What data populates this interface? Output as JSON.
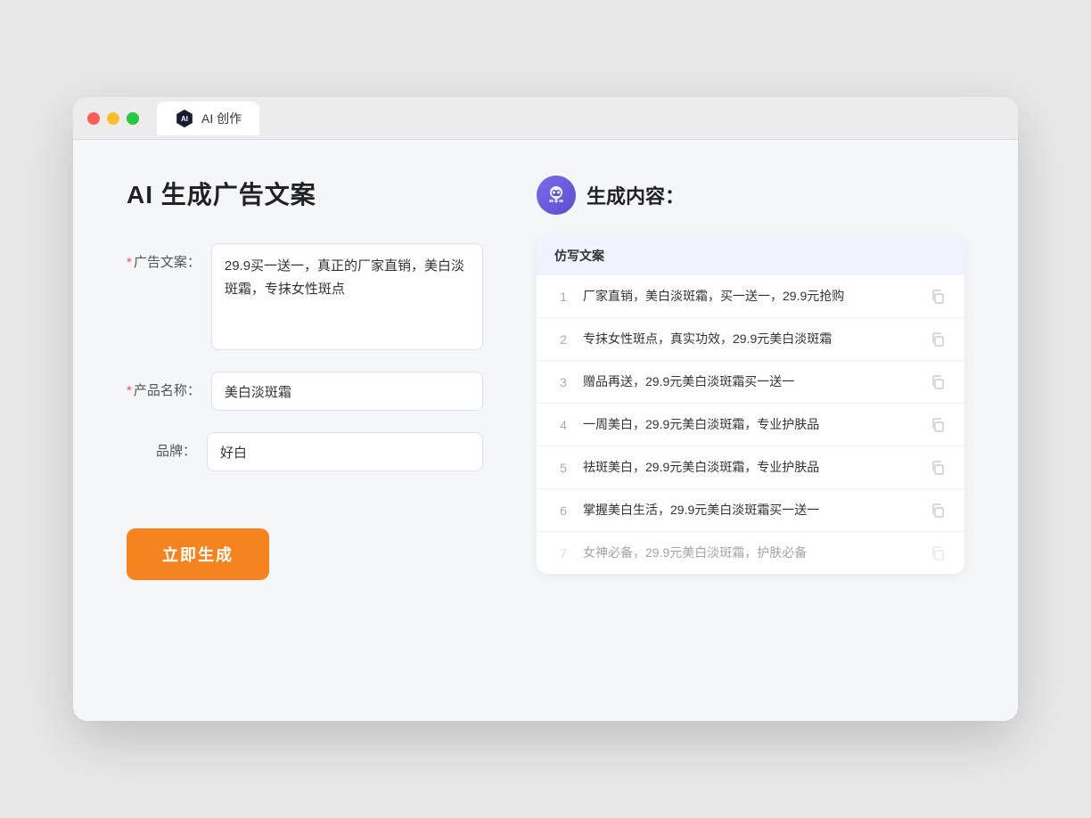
{
  "browser": {
    "tab_label": "AI 创作"
  },
  "page": {
    "title": "AI 生成广告文案"
  },
  "form": {
    "ad_copy_label": "广告文案：",
    "ad_copy_required": "*",
    "ad_copy_value": "29.9买一送一，真正的厂家直销，美白淡斑霜，专抹女性斑点",
    "product_name_label": "产品名称：",
    "product_name_required": "*",
    "product_name_value": "美白淡斑霜",
    "brand_label": "品牌：",
    "brand_value": "好白",
    "generate_button": "立即生成"
  },
  "results": {
    "header_icon_alt": "ai-bot",
    "section_title": "生成内容：",
    "column_label": "仿写文案",
    "items": [
      {
        "num": "1",
        "text": "厂家直销，美白淡斑霜，买一送一，29.9元抢购",
        "faded": false
      },
      {
        "num": "2",
        "text": "专抹女性斑点，真实功效，29.9元美白淡斑霜",
        "faded": false
      },
      {
        "num": "3",
        "text": "赠品再送，29.9元美白淡斑霜买一送一",
        "faded": false
      },
      {
        "num": "4",
        "text": "一周美白，29.9元美白淡斑霜，专业护肤品",
        "faded": false
      },
      {
        "num": "5",
        "text": "祛斑美白，29.9元美白淡斑霜，专业护肤品",
        "faded": false
      },
      {
        "num": "6",
        "text": "掌握美白生活，29.9元美白淡斑霜买一送一",
        "faded": false
      },
      {
        "num": "7",
        "text": "女神必备，29.9元美白淡斑霜，护肤必备",
        "faded": true
      }
    ]
  }
}
